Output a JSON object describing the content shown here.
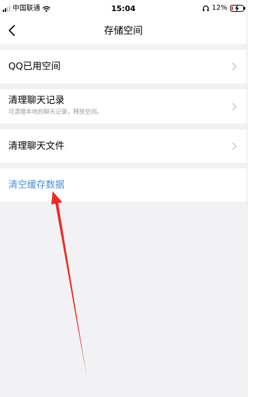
{
  "status_bar": {
    "carrier": "中国联通",
    "time": "15:04",
    "battery": "12%",
    "battery_level": 0.12
  },
  "nav": {
    "title": "存储空间"
  },
  "rows": [
    {
      "title": "QQ已用空间",
      "subtitle": ""
    },
    {
      "title": "清理聊天记录",
      "subtitle": "可清理本地的聊天记录，释放空间。"
    },
    {
      "title": "清理聊天文件",
      "subtitle": ""
    },
    {
      "title": "清空缓存数据",
      "subtitle": ""
    }
  ],
  "colors": {
    "link": "#4a90d9",
    "background": "#f2f2f5",
    "annotation_arrow": "#ee2a24"
  },
  "icons": {
    "back": "chevron-left-icon",
    "row_arrow": "chevron-right-icon",
    "signal": "signal-icon",
    "wifi": "wifi-icon",
    "headphones": "headphone-icon",
    "battery": "battery-icon"
  }
}
